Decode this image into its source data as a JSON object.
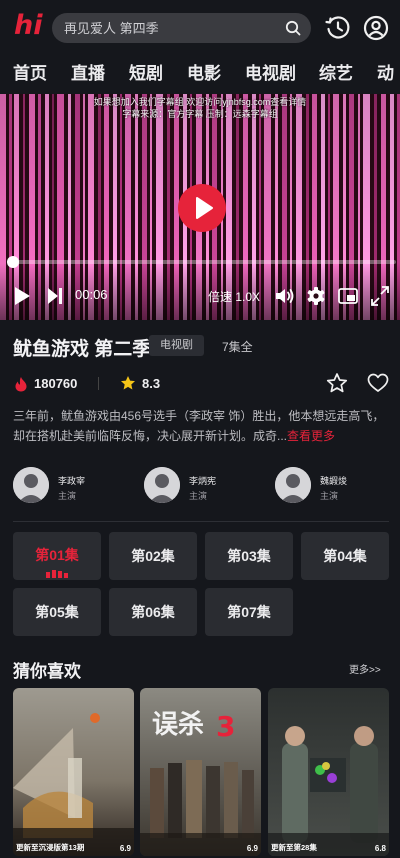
{
  "header": {
    "logo_text": "hi",
    "search_placeholder": "再见爱人 第四季",
    "icons": [
      "search-icon",
      "history-icon",
      "user-icon"
    ]
  },
  "categories": [
    "首页",
    "直播",
    "短剧",
    "电影",
    "电视剧",
    "综艺",
    "动"
  ],
  "player": {
    "notice_line1": "如果想加入我们字幕组 欢迎访问yjnbfsg.com查看详情",
    "notice_line2": "字幕来源：官方字幕 压制：远森字幕组",
    "current_time": "00:06",
    "speed_label": "倍速 1.0X",
    "progress": 0.008
  },
  "show": {
    "title": "鱿鱼游戏 第二季",
    "tag": "电视剧",
    "episodes_total": "7集全",
    "heat": "180760",
    "score": "8.3",
    "description": "三年前，鱿鱼游戏由456号选手（李政宰 饰）胜出，他本想远走高飞，却在搭机赴美前临阵反悔，决心展开新计划。成奇...",
    "more_label": "查看更多"
  },
  "cast": [
    {
      "name": "李政宰",
      "role": "主演"
    },
    {
      "name": "李炳宪",
      "role": "主演"
    },
    {
      "name": "魏嘏焌",
      "role": "主演"
    }
  ],
  "episodes": [
    "第01集",
    "第02集",
    "第03集",
    "第04集",
    "第05集",
    "第06集",
    "第07集"
  ],
  "active_episode": 0,
  "recommend": {
    "title": "猜你喜欢",
    "more_label": "更多>>",
    "items": [
      {
        "caption": "更新至沉浸版第13期",
        "score": "6.9"
      },
      {
        "caption": "",
        "score": "6.9"
      },
      {
        "caption": "更新至第28集",
        "score": "6.8"
      }
    ]
  },
  "colors": {
    "accent": "#e6233a",
    "background": "#15171c",
    "button": "#2a2c31",
    "star": "#f5c518"
  }
}
